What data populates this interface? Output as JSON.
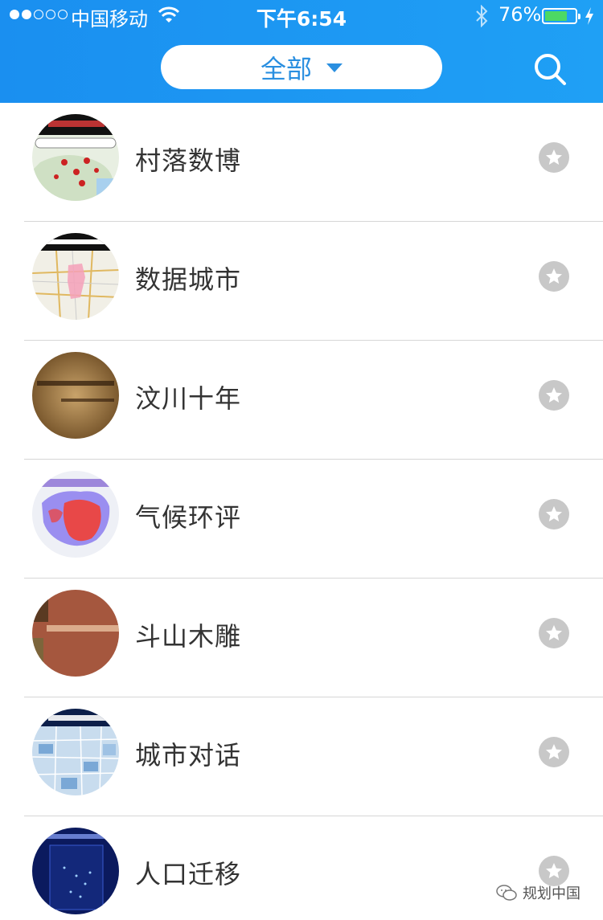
{
  "status": {
    "carrier": "中国移动",
    "time": "下午6:54",
    "battery": "76%",
    "battery_level": 0.76,
    "signal_bars_filled": 2,
    "signal_bars_total": 5
  },
  "header": {
    "filter_label": "全部",
    "accent_color": "#1a8ff0"
  },
  "items": [
    {
      "label": "村落数博",
      "thumb": "map-thumbnail"
    },
    {
      "label": "数据城市",
      "thumb": "city-map-thumbnail"
    },
    {
      "label": "汶川十年",
      "thumb": "memorial-thumbnail"
    },
    {
      "label": "气候环评",
      "thumb": "climate-map-thumbnail"
    },
    {
      "label": "斗山木雕",
      "thumb": "wood-carving-thumbnail"
    },
    {
      "label": "城市对话",
      "thumb": "city-dialog-thumbnail"
    },
    {
      "label": "人口迁移",
      "thumb": "population-map-thumbnail"
    }
  ],
  "watermark": {
    "text": "规划中国",
    "icon": "wechat-icon"
  }
}
